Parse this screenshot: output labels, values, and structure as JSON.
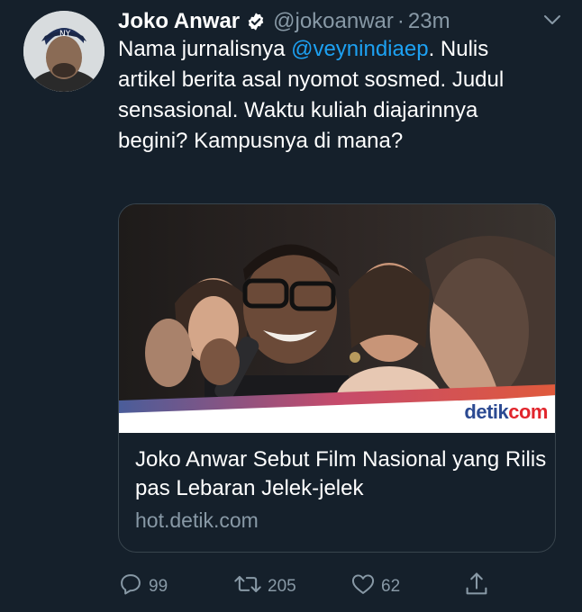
{
  "tweet": {
    "author_name": "Joko Anwar",
    "author_handle": "@jokoanwar",
    "separator": "·",
    "time": "23m",
    "text_before_mention": "Nama jurnalisnya ",
    "mention": "@veynindiaep",
    "text_after_mention": ". Nulis artikel berita asal nyomot sosmed. Judul sensasional. Waktu kuliah diajarinnya begini? Kampusnya di mana?"
  },
  "card": {
    "title": "Joko Anwar Sebut Film Nasional yang Rilis pas Lebaran Jelek-jelek",
    "domain": "hot.detik.com",
    "brand_part1": "detik",
    "brand_part2": "com"
  },
  "actions": {
    "reply_count": "99",
    "retweet_count": "205",
    "like_count": "62"
  },
  "colors": {
    "background": "#15202b",
    "link": "#1da1f2",
    "muted": "#8899a6",
    "verified": "#ffffff",
    "border": "#38444d"
  },
  "icons": [
    "verified-badge-icon",
    "chevron-down-icon",
    "reply-icon",
    "retweet-icon",
    "like-icon",
    "share-icon"
  ]
}
